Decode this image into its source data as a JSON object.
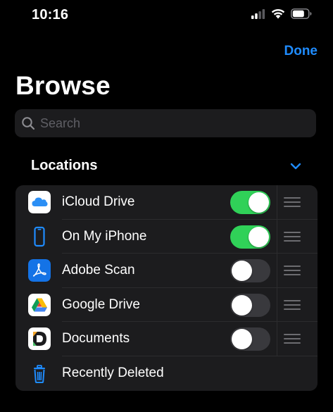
{
  "status_bar": {
    "time": "10:16"
  },
  "nav": {
    "done_label": "Done"
  },
  "page": {
    "title": "Browse"
  },
  "search": {
    "placeholder": "Search",
    "value": ""
  },
  "locations": {
    "header": "Locations",
    "items": [
      {
        "label": "iCloud Drive",
        "icon": "icloud-drive-icon",
        "toggle": true
      },
      {
        "label": "On My iPhone",
        "icon": "iphone-icon",
        "toggle": true
      },
      {
        "label": "Adobe Scan",
        "icon": "adobe-scan-icon",
        "toggle": false
      },
      {
        "label": "Google Drive",
        "icon": "google-drive-icon",
        "toggle": false
      },
      {
        "label": "Documents",
        "icon": "documents-app-icon",
        "toggle": false
      },
      {
        "label": "Recently Deleted",
        "icon": "trash-icon"
      }
    ]
  },
  "colors": {
    "accent": "#1f8cff",
    "toggle_on": "#30d158",
    "toggle_off": "#39393d",
    "panel": "#1c1c1e",
    "background": "#000000"
  }
}
